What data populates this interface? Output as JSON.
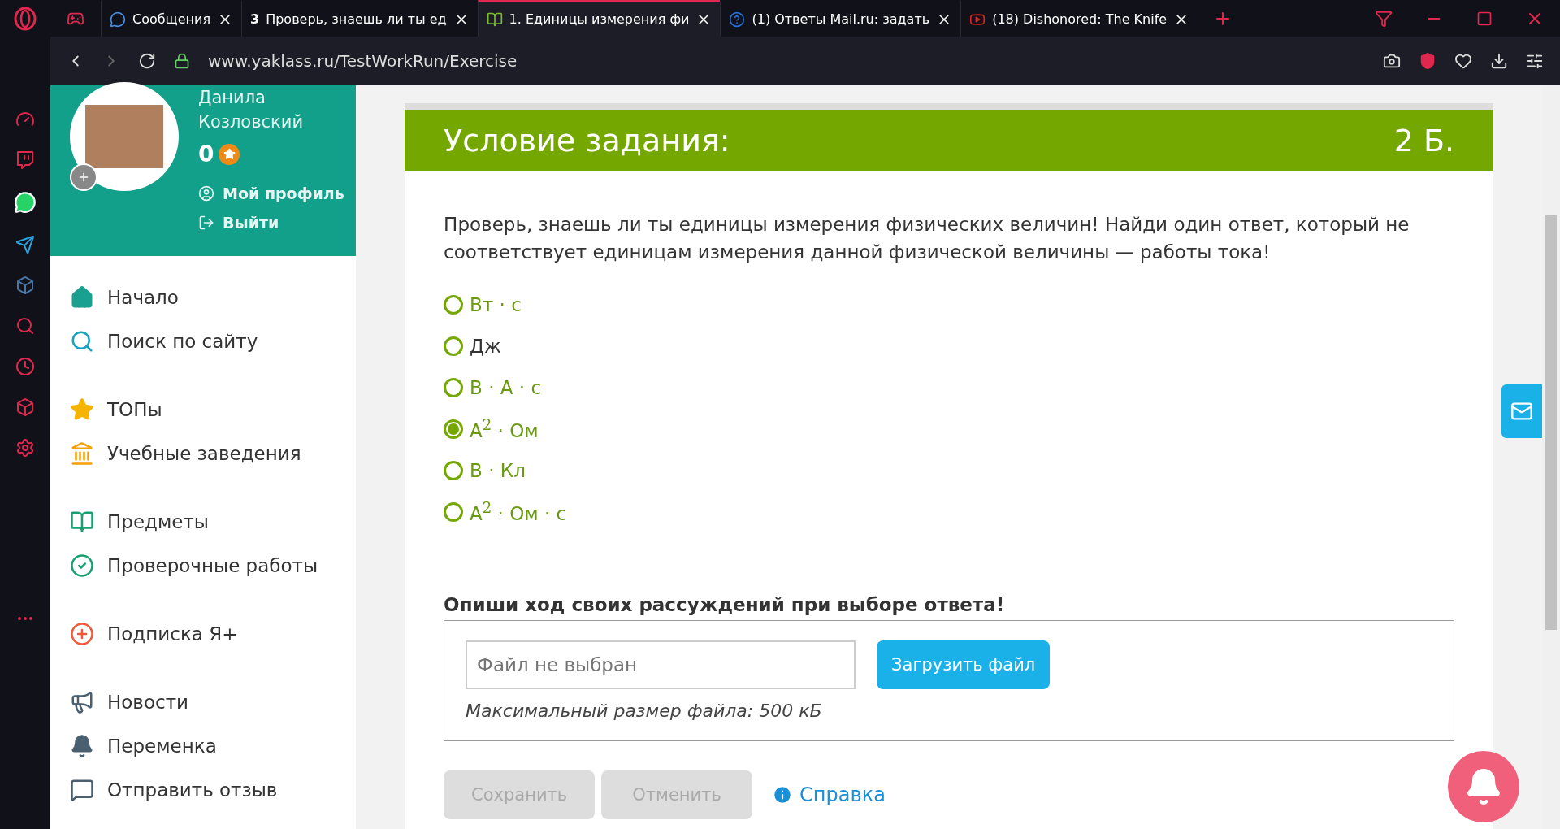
{
  "browser": {
    "tabs": [
      {
        "label": "Сообщения",
        "selected": false,
        "kind": "chat"
      },
      {
        "label": "Проверь, знаешь ли ты ед",
        "selected": false,
        "kind": "number",
        "badge": "3"
      },
      {
        "label": "1. Единицы измерения фи",
        "selected": true,
        "kind": "book"
      },
      {
        "label": "(1) Ответы Mail.ru: задать",
        "selected": false,
        "kind": "question"
      },
      {
        "label": "(18) Dishonored: The Knife",
        "selected": false,
        "kind": "video"
      }
    ],
    "url": "www.yaklass.ru/TestWorkRun/Exercise"
  },
  "profile": {
    "first_name": "Данила",
    "last_name": "Козловский",
    "points": "0",
    "links": [
      "Мой профиль",
      "Выйти"
    ]
  },
  "menu": [
    {
      "label": "Начало"
    },
    {
      "label": "Поиск по сайту"
    },
    {
      "label": "ТОПы"
    },
    {
      "label": "Учебные заведения"
    },
    {
      "label": "Предметы"
    },
    {
      "label": "Проверочные работы"
    },
    {
      "label": "Подписка Я+"
    },
    {
      "label": "Новости"
    },
    {
      "label": "Переменка"
    },
    {
      "label": "Отправить отзыв"
    }
  ],
  "task": {
    "title": "Условие задания:",
    "score": "2 Б.",
    "question": "Проверь, знаешь ли ты единицы измерения физических величин! Найди один ответ, который не соответствует единицам измерения данной физической величины — работы тока!",
    "options": [
      {
        "label": "Вт · с",
        "selected": false,
        "kind": "math"
      },
      {
        "label": "Дж",
        "selected": false,
        "kind": "plain"
      },
      {
        "label": "В · А · с",
        "selected": false,
        "kind": "math"
      },
      {
        "label": "А$^{2}$ · Ом",
        "selected": true,
        "kind": "math"
      },
      {
        "label": "В · Кл",
        "selected": false,
        "kind": "math"
      },
      {
        "label": "А$^{2}$ · Ом · с",
        "selected": false,
        "kind": "math"
      }
    ],
    "reasoning_title": "Опиши ход своих рассуждений при выборе ответа!",
    "file_placeholder": "Файл не выбран",
    "upload_button": "Загрузить файл",
    "file_note": "Максимальный размер файла: 500 кБ",
    "buttons": [
      {
        "label": "Сохранить",
        "disabled": true
      },
      {
        "label": "Отменить",
        "disabled": true
      }
    ],
    "help_link": "Справка"
  }
}
